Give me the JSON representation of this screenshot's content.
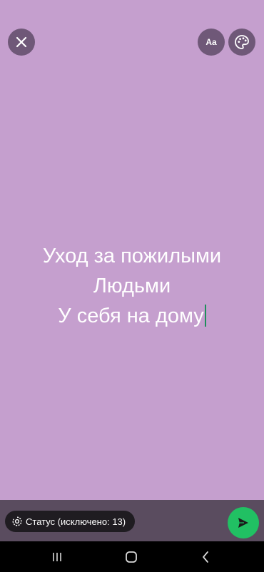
{
  "colors": {
    "canvas_background": "#c59fce",
    "top_button_background": "#6f5878",
    "bottom_bar_background": "#5a4c5f",
    "chip_background": "#1f1c21",
    "send_button": "#21c063",
    "cursor": "#1e8f5a",
    "nav_bar": "#000000"
  },
  "toolbar": {
    "close_icon": "close-icon",
    "font_button_label": "Aa",
    "palette_icon": "palette-icon"
  },
  "status": {
    "lines": [
      "Уход за пожилыми",
      "Людьми",
      "У себя на дому"
    ]
  },
  "bottom_bar": {
    "privacy_icon": "status-privacy-icon",
    "privacy_label": "Статус (исключено: 13)",
    "send_icon": "send-icon"
  },
  "nav": {
    "recents_icon": "recents-icon",
    "home_icon": "home-icon",
    "back_icon": "back-icon"
  }
}
